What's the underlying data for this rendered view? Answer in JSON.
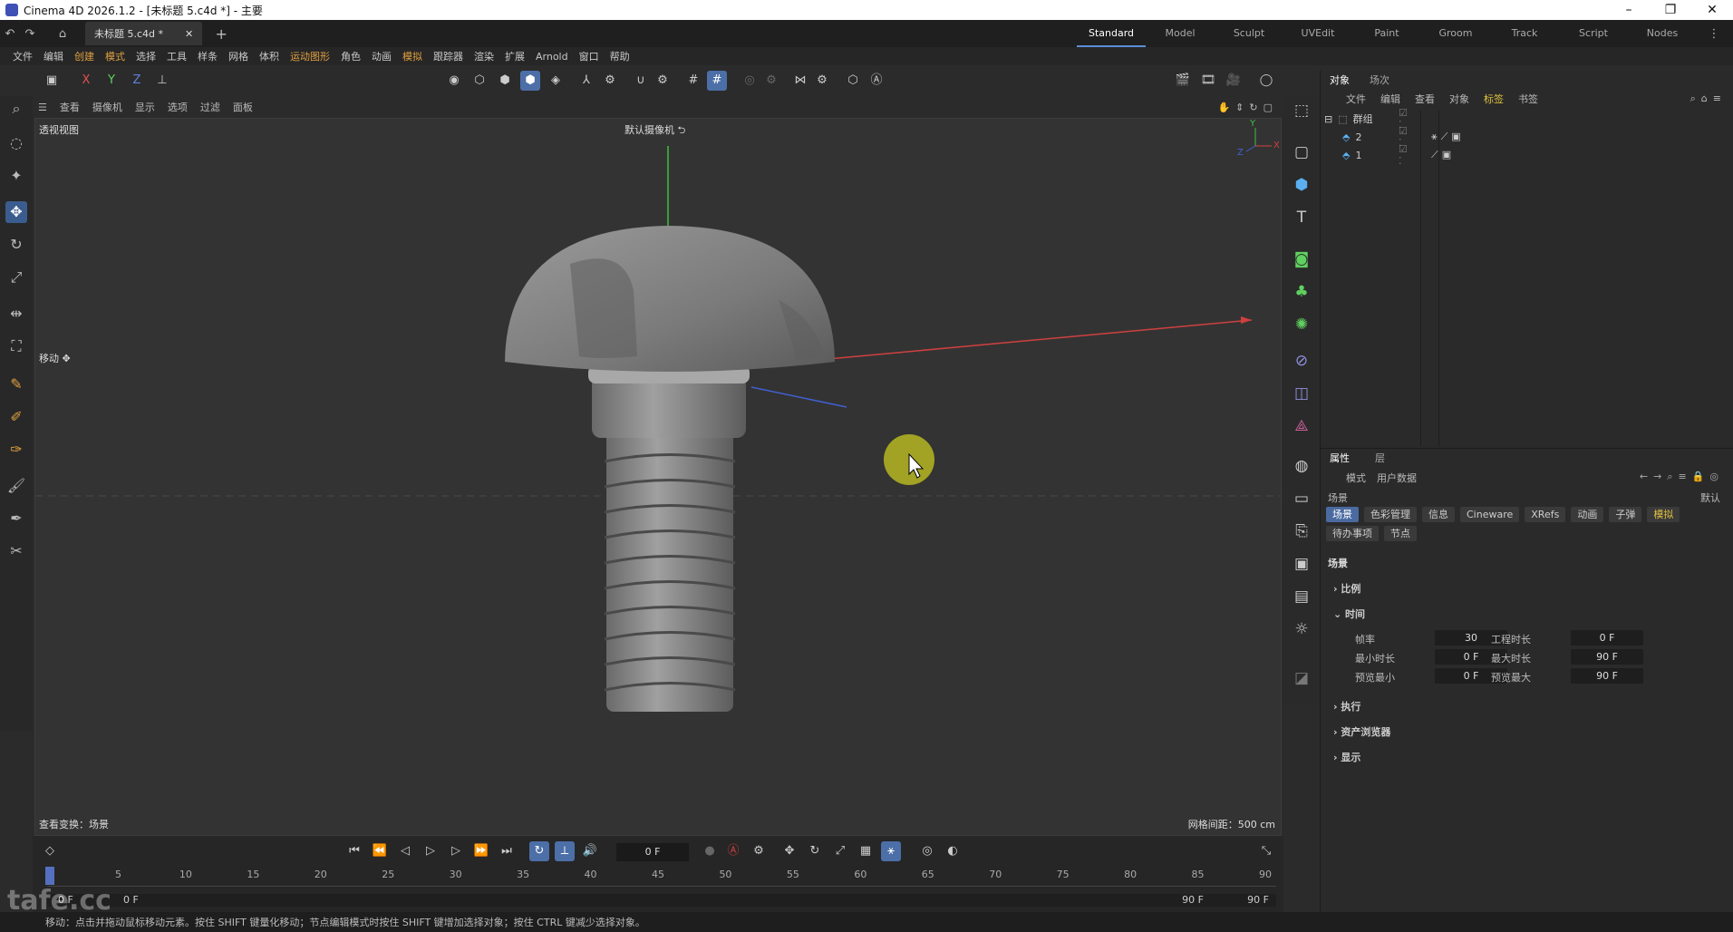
{
  "window": {
    "title": "Cinema 4D 2026.1.2 - [未标题 5.c4d *] - 主要",
    "controls": [
      "–",
      "❐",
      "✕"
    ]
  },
  "doc_tab": {
    "label": "未标题 5.c4d *",
    "close": "✕",
    "add": "+"
  },
  "layouts": [
    "Standard",
    "Model",
    "Sculpt",
    "UVEdit",
    "Paint",
    "Groom",
    "Track",
    "Script",
    "Nodes"
  ],
  "menus": [
    "文件",
    "编辑",
    "创建",
    "模式",
    "选择",
    "工具",
    "样条",
    "网格",
    "体积",
    "运动图形",
    "角色",
    "动画",
    "模拟",
    "跟踪器",
    "渲染",
    "扩展",
    "Arnold",
    "窗口",
    "帮助"
  ],
  "axis_buttons": [
    "X",
    "Y",
    "Z"
  ],
  "viewport_menu": [
    "查看",
    "摄像机",
    "显示",
    "选项",
    "过滤",
    "面板"
  ],
  "viewport": {
    "name": "透视视图",
    "camera": "默认摄像机 ⮌",
    "tool_label": "移动 ✥",
    "status_left": "查看变换：场景",
    "status_right": "网格间距：500 cm",
    "axis_y": "Y",
    "axis_x": "X",
    "axis_z": "Z"
  },
  "object_manager": {
    "tabs": [
      "对象",
      "场次"
    ],
    "menu": [
      "文件",
      "编辑",
      "查看",
      "对象",
      "标签",
      "书签"
    ],
    "objects": [
      {
        "name": "群组",
        "level": 0
      },
      {
        "name": "2",
        "level": 1
      },
      {
        "name": "1",
        "level": 1
      }
    ]
  },
  "attributes": {
    "tabs": [
      "属性",
      "层"
    ],
    "menu": [
      "模式",
      "用户数据"
    ],
    "scene_label": "场景",
    "preset": "默认",
    "buttons": [
      "场景",
      "色彩管理",
      "信息",
      "Cineware",
      "XRefs",
      "动画",
      "子弹",
      "模拟",
      "待办事项",
      "节点"
    ],
    "section": "场景",
    "groups": [
      "比例",
      "时间",
      "执行",
      "资产浏览器",
      "显示"
    ],
    "fields": {
      "fps_label": "帧率",
      "fps": "30",
      "doc_length_label": "工程时长",
      "doc_length": "0 F",
      "min_time_label": "最小时长",
      "min_time": "0 F",
      "max_time_label": "最大时长",
      "max_time": "90 F",
      "preview_min_label": "预览最小",
      "preview_min": "0 F",
      "preview_max_label": "预览最大",
      "preview_max": "90 F"
    }
  },
  "timeline": {
    "current_frame": "0 F",
    "ticks": [
      "0",
      "5",
      "10",
      "15",
      "20",
      "25",
      "30",
      "35",
      "40",
      "45",
      "50",
      "55",
      "60",
      "65",
      "70",
      "75",
      "80",
      "85",
      "90"
    ],
    "range_start": "0 F",
    "range_start2": "0 F",
    "range_end": "90 F",
    "range_end2": "90 F"
  },
  "status": "移动：点击并拖动鼠标移动元素。按住 SHIFT 键量化移动；节点编辑模式时按住 SHIFT 键增加选择对象；按住 CTRL 键减少选择对象。",
  "watermark": "tafe.cc",
  "colors": {
    "accent": "#4c6fa8",
    "orange_menu": "#e0a040",
    "x_axis": "#d04040",
    "y_axis": "#40c040",
    "z_axis": "#4060d0",
    "cursor_highlight": "#c8c820"
  }
}
